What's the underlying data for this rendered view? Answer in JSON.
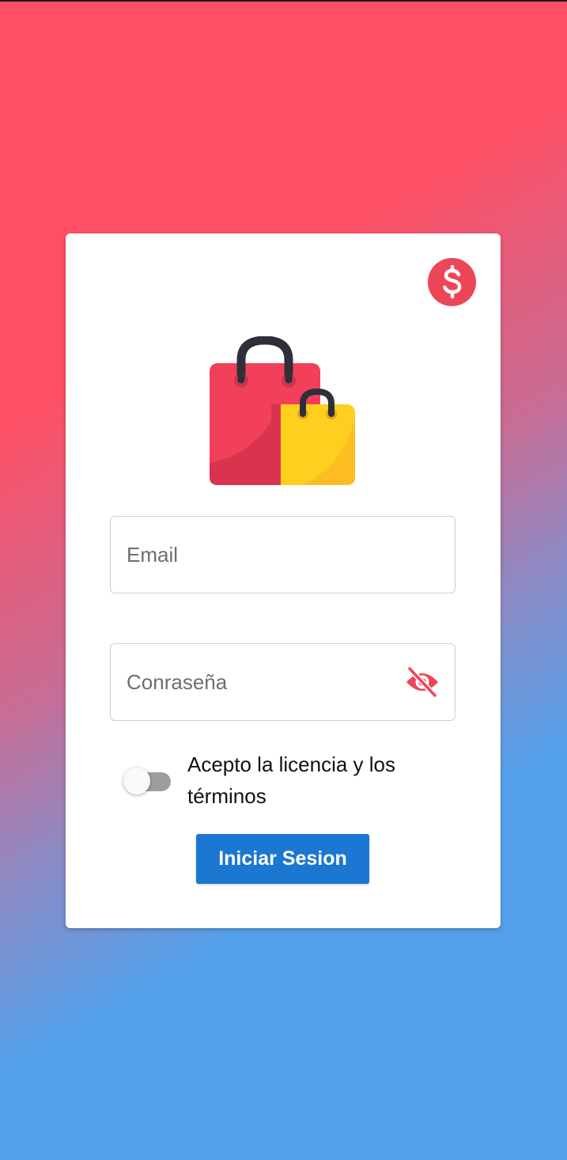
{
  "login": {
    "email_placeholder": "Email",
    "password_placeholder": "Conraseña",
    "terms_label": "Acepto la licencia y los términos",
    "terms_accepted": false,
    "submit_label": "Iniciar Sesion"
  },
  "icons": {
    "badge": "dollar-icon",
    "logo": "shopping-bags-icon",
    "password_visibility": "eye-off-icon"
  },
  "colors": {
    "gradient_top": "#ff4f64",
    "gradient_bottom": "#55a0ea",
    "accent": "#ed4658",
    "button": "#1b77d2",
    "bag_red": "#f2405a",
    "bag_yellow": "#ffcf1f"
  }
}
